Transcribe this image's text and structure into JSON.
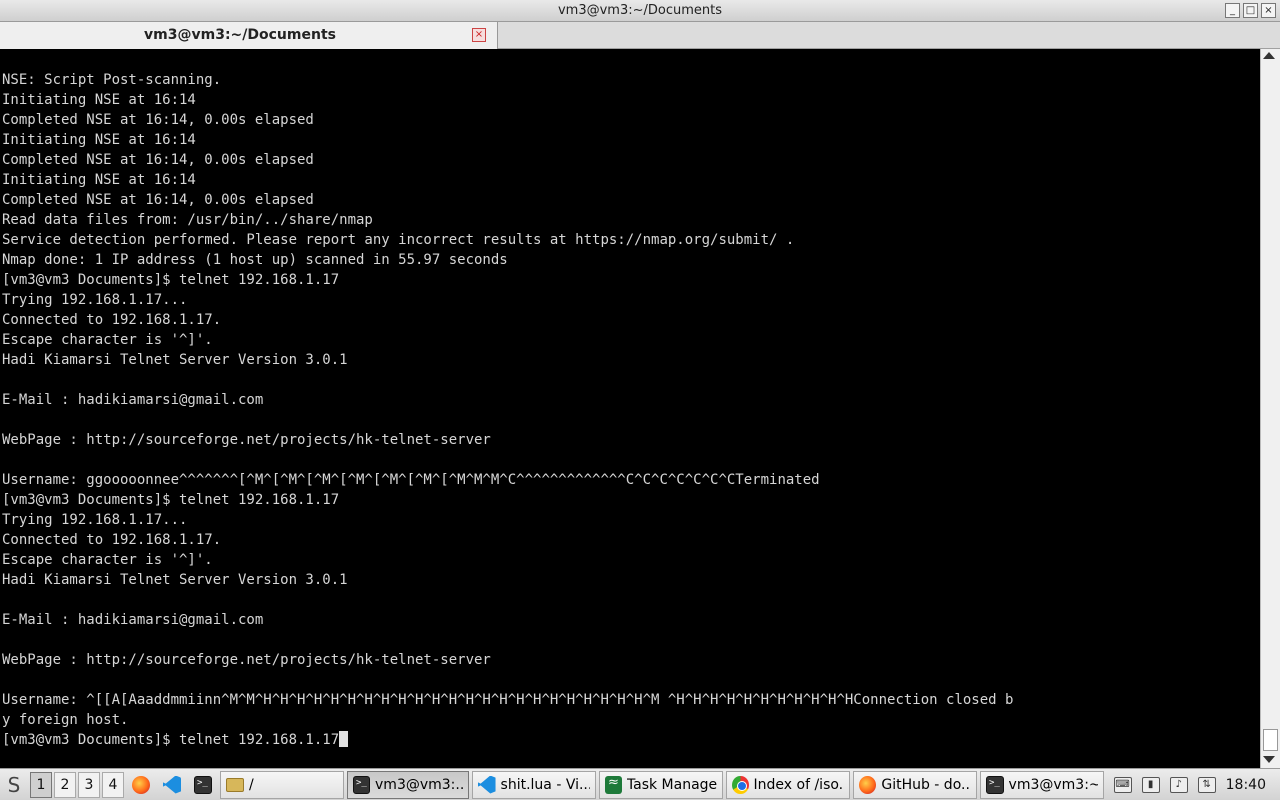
{
  "window": {
    "title": "vm3@vm3:~/Documents",
    "controls": {
      "minimize": "_",
      "maximize": "□",
      "close": "×"
    }
  },
  "tab": {
    "label": "vm3@vm3:~/Documents",
    "close": "×"
  },
  "terminal": {
    "lines": [
      "NSE: Script Post-scanning.",
      "Initiating NSE at 16:14",
      "Completed NSE at 16:14, 0.00s elapsed",
      "Initiating NSE at 16:14",
      "Completed NSE at 16:14, 0.00s elapsed",
      "Initiating NSE at 16:14",
      "Completed NSE at 16:14, 0.00s elapsed",
      "Read data files from: /usr/bin/../share/nmap",
      "Service detection performed. Please report any incorrect results at https://nmap.org/submit/ .",
      "Nmap done: 1 IP address (1 host up) scanned in 55.97 seconds",
      "[vm3@vm3 Documents]$ telnet 192.168.1.17",
      "Trying 192.168.1.17...",
      "Connected to 192.168.1.17.",
      "Escape character is '^]'.",
      "Hadi Kiamarsi Telnet Server Version 3.0.1",
      "",
      "E-Mail : hadikiamarsi@gmail.com",
      "",
      "WebPage : http://sourceforge.net/projects/hk-telnet-server",
      "",
      "Username: ggooooonnee^^^^^^^[^M^[^M^[^M^[^M^[^M^[^M^[^M^M^M^C^^^^^^^^^^^^^C^C^C^C^C^C^CTerminated",
      "[vm3@vm3 Documents]$ telnet 192.168.1.17",
      "Trying 192.168.1.17...",
      "Connected to 192.168.1.17.",
      "Escape character is '^]'.",
      "Hadi Kiamarsi Telnet Server Version 3.0.1",
      "",
      "E-Mail : hadikiamarsi@gmail.com",
      "",
      "WebPage : http://sourceforge.net/projects/hk-telnet-server",
      "",
      "Username: ^[[A[Aaaddmmiinn^M^M^H^H^H^H^H^H^H^H^H^H^H^H^H^H^H^H^H^H^H^H^H^H^H^M ^H^H^H^H^H^H^H^H^H^H^HConnection closed b",
      "y foreign host.",
      "[vm3@vm3 Documents]$ telnet 192.168.1.17"
    ]
  },
  "taskbar": {
    "menu_icon": "S",
    "workspaces": [
      "1",
      "2",
      "3",
      "4"
    ],
    "windows": [
      {
        "label": "/",
        "icon": "folder-icon"
      },
      {
        "label": "vm3@vm3:...",
        "icon": "terminal-icon"
      },
      {
        "label": "shit.lua - Vi...",
        "icon": "vscode-icon"
      },
      {
        "label": "Task Manager",
        "icon": "task-manager-icon"
      },
      {
        "label": "Index of /iso...",
        "icon": "chrome-icon"
      },
      {
        "label": "GitHub - do...",
        "icon": "firefox-icon"
      },
      {
        "label": "vm3@vm3:~",
        "icon": "terminal-icon"
      }
    ],
    "clock": "18:40"
  }
}
